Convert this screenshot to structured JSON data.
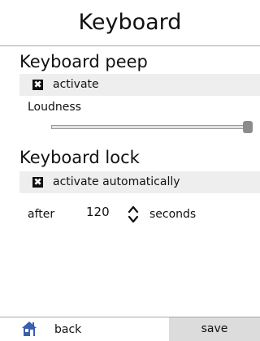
{
  "header": {
    "title": "Keyboard"
  },
  "keyboard_peep": {
    "heading": "Keyboard peep",
    "activate_label": "activate",
    "activate_checked": true,
    "loudness_label": "Loudness",
    "loudness_level": 1.0
  },
  "keyboard_lock": {
    "heading": "Keyboard lock",
    "auto_label": "activate automatically",
    "auto_checked": true,
    "after_label": "after",
    "seconds_value": "120",
    "seconds_label": "seconds"
  },
  "footer": {
    "back_label": "back",
    "back_icon": "home-icon",
    "save_label": "save"
  },
  "colors": {
    "band": "#eeeeee",
    "save_bg": "#dcdcdc",
    "thumb": "#8c8c8c",
    "home_icon": "#3a5fb0"
  }
}
